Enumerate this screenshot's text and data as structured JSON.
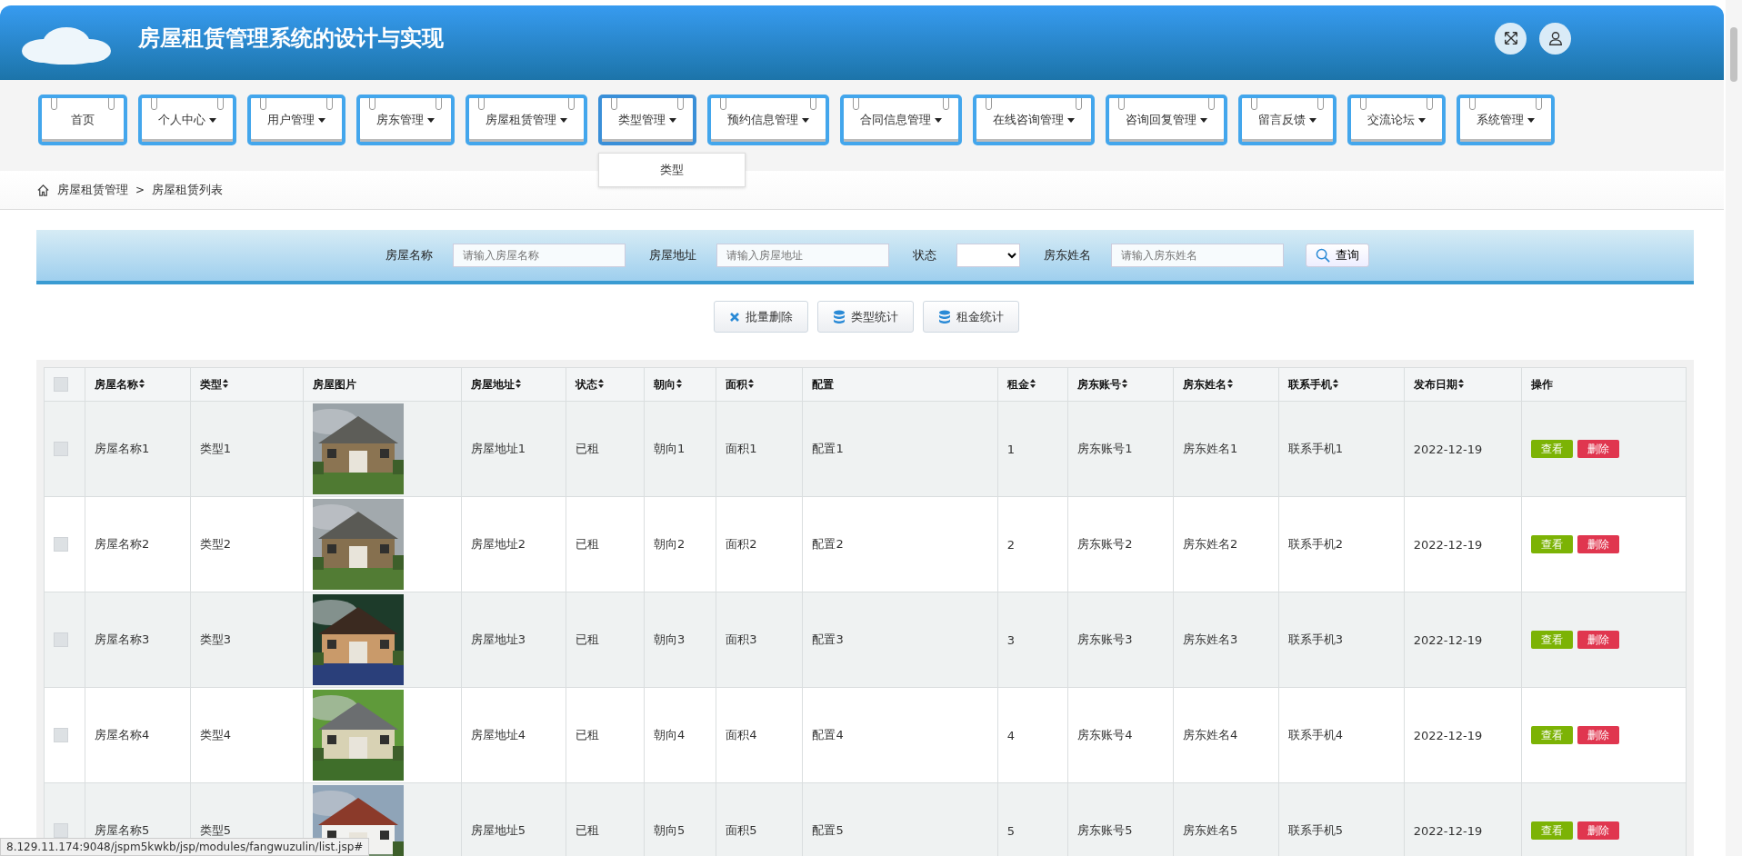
{
  "header": {
    "title": "房屋租赁管理系统的设计与实现"
  },
  "nav": [
    {
      "label": "首页",
      "has_menu": false,
      "expanded": false
    },
    {
      "label": "个人中心",
      "has_menu": true,
      "expanded": false
    },
    {
      "label": "用户管理",
      "has_menu": true,
      "expanded": false
    },
    {
      "label": "房东管理",
      "has_menu": true,
      "expanded": false
    },
    {
      "label": "房屋租赁管理",
      "has_menu": true,
      "expanded": false
    },
    {
      "label": "类型管理",
      "has_menu": true,
      "expanded": true,
      "menu": [
        "类型"
      ]
    },
    {
      "label": "预约信息管理",
      "has_menu": true,
      "expanded": false
    },
    {
      "label": "合同信息管理",
      "has_menu": true,
      "expanded": false
    },
    {
      "label": "在线咨询管理",
      "has_menu": true,
      "expanded": false
    },
    {
      "label": "咨询回复管理",
      "has_menu": true,
      "expanded": false
    },
    {
      "label": "留言反馈",
      "has_menu": true,
      "expanded": false
    },
    {
      "label": "交流论坛",
      "has_menu": true,
      "expanded": false
    },
    {
      "label": "系统管理",
      "has_menu": true,
      "expanded": false
    }
  ],
  "breadcrumb": [
    "房屋租赁管理",
    "房屋租赁列表"
  ],
  "breadcrumb_separator": ">",
  "search": {
    "fields": [
      {
        "kind": "text",
        "label": "房屋名称",
        "placeholder": "请输入房屋名称"
      },
      {
        "kind": "text",
        "label": "房屋地址",
        "placeholder": "请输入房屋地址"
      },
      {
        "kind": "select",
        "label": "状态"
      },
      {
        "kind": "text",
        "label": "房东姓名",
        "placeholder": "请输入房东姓名"
      }
    ],
    "button": "查询"
  },
  "actions": [
    {
      "kind": "delete",
      "label": "批量删除"
    },
    {
      "kind": "stats",
      "label": "类型统计"
    },
    {
      "kind": "stats",
      "label": "租金统计"
    }
  ],
  "table": {
    "all_checked": false,
    "columns": [
      {
        "label": "房屋名称",
        "sortable": true
      },
      {
        "label": "类型",
        "sortable": true
      },
      {
        "label": "房屋图片",
        "sortable": false
      },
      {
        "label": "房屋地址",
        "sortable": true
      },
      {
        "label": "状态",
        "sortable": true
      },
      {
        "label": "朝向",
        "sortable": true
      },
      {
        "label": "面积",
        "sortable": true
      },
      {
        "label": "配置",
        "sortable": false
      },
      {
        "label": "租金",
        "sortable": true
      },
      {
        "label": "房东账号",
        "sortable": true
      },
      {
        "label": "房东姓名",
        "sortable": true
      },
      {
        "label": "联系手机",
        "sortable": true
      },
      {
        "label": "发布日期",
        "sortable": true
      },
      {
        "label": "操作",
        "sortable": false
      }
    ],
    "rows": [
      {
        "checked": false,
        "cells": [
          "房屋名称1",
          "类型1",
          null,
          "房屋地址1",
          "已租",
          "朝向1",
          "面积1",
          "配置1",
          "1",
          "房东账号1",
          "房东姓名1",
          "联系手机1",
          "2022-12-19"
        ],
        "buttons": [
          "查看",
          "删除"
        ]
      },
      {
        "checked": false,
        "cells": [
          "房屋名称2",
          "类型2",
          null,
          "房屋地址2",
          "已租",
          "朝向2",
          "面积2",
          "配置2",
          "2",
          "房东账号2",
          "房东姓名2",
          "联系手机2",
          "2022-12-19"
        ],
        "buttons": [
          "查看",
          "删除"
        ]
      },
      {
        "checked": false,
        "cells": [
          "房屋名称3",
          "类型3",
          null,
          "房屋地址3",
          "已租",
          "朝向3",
          "面积3",
          "配置3",
          "3",
          "房东账号3",
          "房东姓名3",
          "联系手机3",
          "2022-12-19"
        ],
        "buttons": [
          "查看",
          "删除"
        ]
      },
      {
        "checked": false,
        "cells": [
          "房屋名称4",
          "类型4",
          null,
          "房屋地址4",
          "已租",
          "朝向4",
          "面积4",
          "配置4",
          "4",
          "房东账号4",
          "房东姓名4",
          "联系手机4",
          "2022-12-19"
        ],
        "buttons": [
          "查看",
          "删除"
        ]
      },
      {
        "checked": false,
        "cells": [
          "房屋名称5",
          "类型5",
          null,
          "房屋地址5",
          "已租",
          "朝向5",
          "面积5",
          "配置5",
          "5",
          "房东账号5",
          "房东姓名5",
          "联系手机5",
          "2022-12-19"
        ],
        "buttons": [
          "查看",
          "删除"
        ]
      }
    ]
  },
  "status_bar": {
    "url": "8.129.11.174:9048/jspm5kwkb/jsp/modules/fangwuzulin/list.jsp#"
  }
}
